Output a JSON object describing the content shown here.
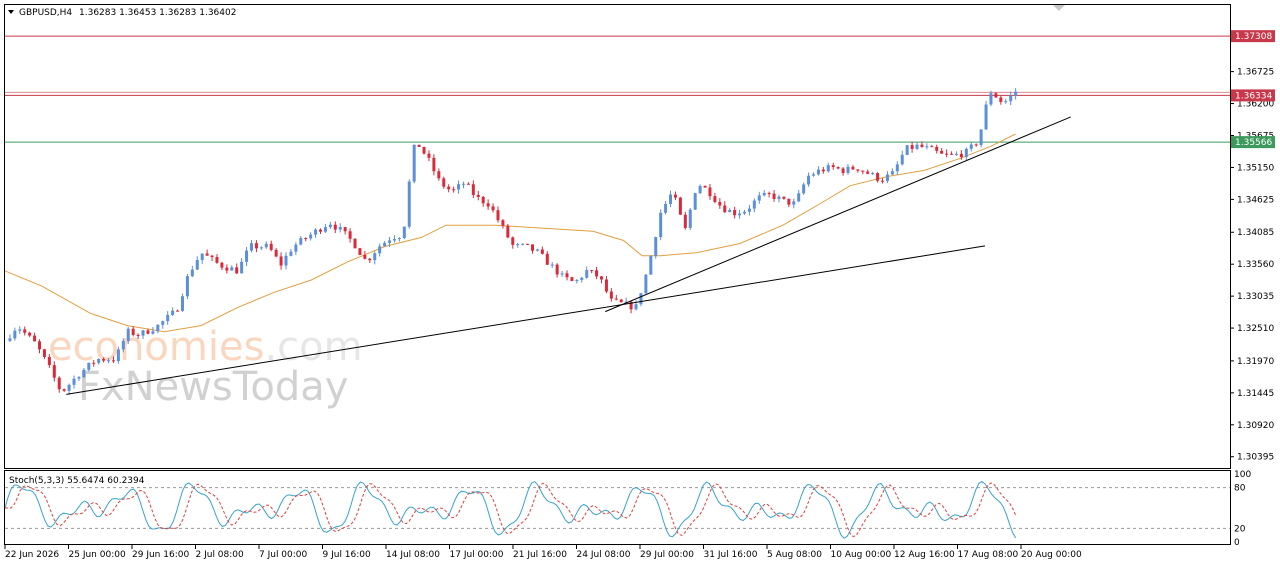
{
  "header": {
    "symbol": "GBPUSD,H4",
    "ohlc": "1.36283 1.36453 1.36283 1.36402"
  },
  "watermark": {
    "brand_prefix": "ec",
    "brand_main": "onomies",
    "brand_suffix": ".com",
    "sub_brand": "FxNewsToday"
  },
  "colors": {
    "bull": "#5b8fd8",
    "bear": "#d92a3a",
    "ma": "#e0a040",
    "resistance": "#c9384a",
    "support": "#3b9a5c",
    "stoch_main": "#3aa3c8",
    "stoch_signal": "#e04040"
  },
  "chart_data": {
    "type": "candlestick",
    "instrument": "GBPUSD",
    "timeframe": "H4",
    "price_axis": {
      "ticks": [
        "1.37308",
        "1.36725",
        "1.36200",
        "1.35675",
        "1.35150",
        "1.34625",
        "1.34085",
        "1.33560",
        "1.33035",
        "1.32510",
        "1.31970",
        "1.31445",
        "1.30920",
        "1.30395"
      ],
      "ylim": [
        1.3021,
        1.3782
      ]
    },
    "time_axis": {
      "labels": [
        "22 Jun 2026",
        "25 Jun 00:00",
        "29 Jun 16:00",
        "2 Jul 08:00",
        "7 Jul 00:00",
        "9 Jul 16:00",
        "14 Jul 08:00",
        "17 Jul 00:00",
        "21 Jul 16:00",
        "24 Jul 08:00",
        "29 Jul 00:00",
        "31 Jul 16:00",
        "5 Aug 08:00",
        "10 Aug 00:00",
        "12 Aug 16:00",
        "17 Aug 08:00",
        "20 Aug 00:00"
      ]
    },
    "horizontal_levels": [
      {
        "price": 1.37308,
        "label": "1.37308",
        "color": "#c9384a"
      },
      {
        "price": 1.36334,
        "label": "1.36334",
        "color": "#c9384a"
      },
      {
        "price": 1.35566,
        "label": "1.35566",
        "color": "#3b9a5c"
      }
    ],
    "trendlines": [
      {
        "from": [
          0.05,
          1.3142
        ],
        "to": [
          0.8,
          1.3386
        ]
      },
      {
        "from": [
          0.49,
          1.3278
        ],
        "to": [
          0.87,
          1.3598
        ]
      }
    ],
    "price_path": [
      [
        0.0,
        1.323
      ],
      [
        0.01,
        1.3255
      ],
      [
        0.025,
        1.3225
      ],
      [
        0.035,
        1.319
      ],
      [
        0.046,
        1.3145
      ],
      [
        0.06,
        1.3175
      ],
      [
        0.075,
        1.32
      ],
      [
        0.09,
        1.32
      ],
      [
        0.1,
        1.3245
      ],
      [
        0.11,
        1.324
      ],
      [
        0.125,
        1.3255
      ],
      [
        0.14,
        1.328
      ],
      [
        0.15,
        1.334
      ],
      [
        0.16,
        1.3375
      ],
      [
        0.175,
        1.3355
      ],
      [
        0.19,
        1.3345
      ],
      [
        0.2,
        1.3385
      ],
      [
        0.215,
        1.3385
      ],
      [
        0.225,
        1.3355
      ],
      [
        0.235,
        1.3385
      ],
      [
        0.25,
        1.3405
      ],
      [
        0.265,
        1.3425
      ],
      [
        0.275,
        1.341
      ],
      [
        0.285,
        1.339
      ],
      [
        0.295,
        1.336
      ],
      [
        0.305,
        1.3385
      ],
      [
        0.315,
        1.34
      ],
      [
        0.325,
        1.3405
      ],
      [
        0.33,
        1.349
      ],
      [
        0.335,
        1.356
      ],
      [
        0.345,
        1.353
      ],
      [
        0.355,
        1.349
      ],
      [
        0.365,
        1.3475
      ],
      [
        0.375,
        1.349
      ],
      [
        0.385,
        1.3465
      ],
      [
        0.395,
        1.3455
      ],
      [
        0.405,
        1.342
      ],
      [
        0.415,
        1.3385
      ],
      [
        0.425,
        1.3385
      ],
      [
        0.435,
        1.3375
      ],
      [
        0.445,
        1.3355
      ],
      [
        0.455,
        1.3335
      ],
      [
        0.465,
        1.3325
      ],
      [
        0.475,
        1.3345
      ],
      [
        0.485,
        1.3335
      ],
      [
        0.495,
        1.3295
      ],
      [
        0.505,
        1.329
      ],
      [
        0.515,
        1.3285
      ],
      [
        0.525,
        1.335
      ],
      [
        0.535,
        1.344
      ],
      [
        0.545,
        1.3475
      ],
      [
        0.555,
        1.341
      ],
      [
        0.565,
        1.349
      ],
      [
        0.575,
        1.3475
      ],
      [
        0.585,
        1.345
      ],
      [
        0.595,
        1.344
      ],
      [
        0.605,
        1.3445
      ],
      [
        0.615,
        1.3465
      ],
      [
        0.625,
        1.347
      ],
      [
        0.635,
        1.346
      ],
      [
        0.645,
        1.3455
      ],
      [
        0.655,
        1.35
      ],
      [
        0.665,
        1.351
      ],
      [
        0.675,
        1.3515
      ],
      [
        0.685,
        1.351
      ],
      [
        0.695,
        1.3515
      ],
      [
        0.705,
        1.3505
      ],
      [
        0.715,
        1.3495
      ],
      [
        0.725,
        1.3505
      ],
      [
        0.735,
        1.3545
      ],
      [
        0.745,
        1.355
      ],
      [
        0.755,
        1.3545
      ],
      [
        0.765,
        1.3535
      ],
      [
        0.775,
        1.3535
      ],
      [
        0.785,
        1.354
      ],
      [
        0.795,
        1.356
      ],
      [
        0.8,
        1.361
      ],
      [
        0.805,
        1.364
      ],
      [
        0.815,
        1.362
      ],
      [
        0.825,
        1.364
      ]
    ],
    "ma_path": [
      [
        0.0,
        1.3345
      ],
      [
        0.03,
        1.332
      ],
      [
        0.07,
        1.3275
      ],
      [
        0.1,
        1.3255
      ],
      [
        0.13,
        1.3245
      ],
      [
        0.16,
        1.3255
      ],
      [
        0.19,
        1.3285
      ],
      [
        0.22,
        1.331
      ],
      [
        0.25,
        1.333
      ],
      [
        0.28,
        1.336
      ],
      [
        0.31,
        1.3385
      ],
      [
        0.34,
        1.34
      ],
      [
        0.36,
        1.342
      ],
      [
        0.4,
        1.342
      ],
      [
        0.44,
        1.3415
      ],
      [
        0.48,
        1.341
      ],
      [
        0.505,
        1.3395
      ],
      [
        0.52,
        1.337
      ],
      [
        0.535,
        1.337
      ],
      [
        0.565,
        1.3375
      ],
      [
        0.6,
        1.339
      ],
      [
        0.635,
        1.342
      ],
      [
        0.665,
        1.3455
      ],
      [
        0.69,
        1.3485
      ],
      [
        0.72,
        1.35
      ],
      [
        0.75,
        1.351
      ],
      [
        0.78,
        1.353
      ],
      [
        0.805,
        1.355
      ],
      [
        0.825,
        1.357
      ]
    ],
    "stochastic": {
      "label": "Stoch(5,3,3) 55.6474 60.2394",
      "levels": {
        "upper": 80,
        "lower": 20
      },
      "axis_ticks": [
        "100",
        "80",
        "20",
        "0"
      ],
      "ylim": [
        0,
        100
      ]
    }
  }
}
